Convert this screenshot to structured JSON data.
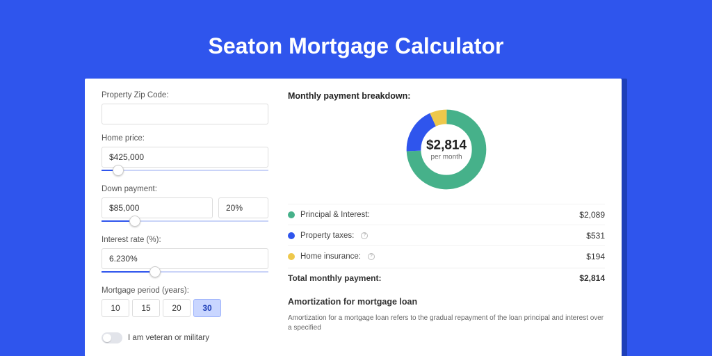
{
  "page_title": "Seaton Mortgage Calculator",
  "form": {
    "zip_label": "Property Zip Code:",
    "zip_value": "",
    "price_label": "Home price:",
    "price_value": "$425,000",
    "price_slider_pct": 10,
    "down_label": "Down payment:",
    "down_value": "$85,000",
    "down_pct": "20%",
    "down_slider_pct": 20,
    "rate_label": "Interest rate (%):",
    "rate_value": "6.230%",
    "rate_slider_pct": 32,
    "period_label": "Mortgage period (years):",
    "periods": [
      "10",
      "15",
      "20",
      "30"
    ],
    "period_selected_index": 3,
    "veteran_label": "I am veteran or military"
  },
  "breakdown": {
    "title": "Monthly payment breakdown:",
    "center_value": "$2,814",
    "center_sub": "per month",
    "items": [
      {
        "label": "Principal & Interest:",
        "value": "$2,089",
        "color": "green",
        "info": false
      },
      {
        "label": "Property taxes:",
        "value": "$531",
        "color": "blue",
        "info": true
      },
      {
        "label": "Home insurance:",
        "value": "$194",
        "color": "yellow",
        "info": true
      }
    ],
    "total_label": "Total monthly payment:",
    "total_value": "$2,814"
  },
  "chart_data": {
    "type": "pie",
    "title": "Monthly payment breakdown",
    "series": [
      {
        "name": "Principal & Interest",
        "value": 2089,
        "color": "#46b18a"
      },
      {
        "name": "Property taxes",
        "value": 531,
        "color": "#2f55ed"
      },
      {
        "name": "Home insurance",
        "value": 194,
        "color": "#eec84b"
      }
    ],
    "total": 2814,
    "center_label": "$2,814 per month"
  },
  "amort": {
    "title": "Amortization for mortgage loan",
    "text": "Amortization for a mortgage loan refers to the gradual repayment of the loan principal and interest over a specified"
  }
}
